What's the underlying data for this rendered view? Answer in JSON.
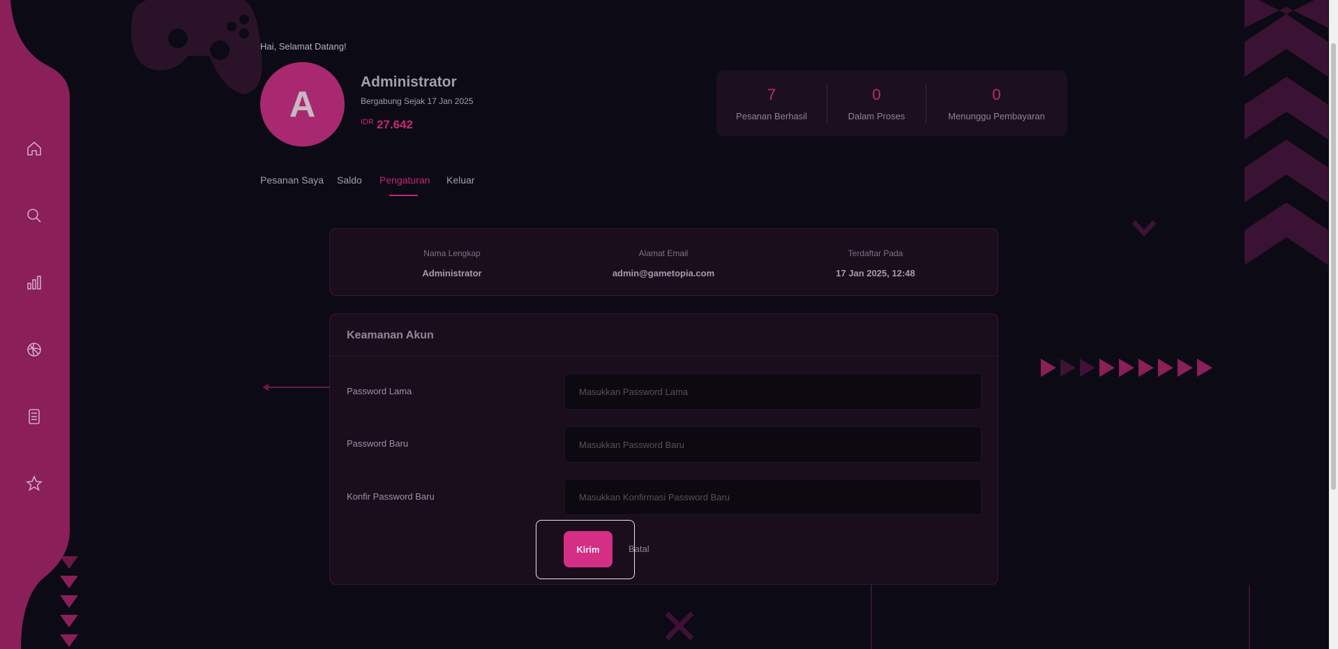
{
  "header": {
    "greeting": "Hai, Selamat Datang!",
    "avatar_initial": "A",
    "user_name": "Administrator",
    "joined": "Bergabung Sejak 17 Jan 2025",
    "balance_currency": "IDR",
    "balance_amount": "27.642"
  },
  "stats": [
    {
      "value": "7",
      "label": "Pesanan Berhasil"
    },
    {
      "value": "0",
      "label": "Dalam Proses"
    },
    {
      "value": "0",
      "label": "Menunggu Pembayaran"
    }
  ],
  "tabs": [
    {
      "label": "Pesanan Saya",
      "active": false
    },
    {
      "label": "Saldo",
      "active": false
    },
    {
      "label": "Pengaturan",
      "active": true
    },
    {
      "label": "Keluar",
      "active": false
    }
  ],
  "info": [
    {
      "key": "Nama Lengkap",
      "value": "Administrator"
    },
    {
      "key": "Alamat Email",
      "value": "admin@gametopia.com"
    },
    {
      "key": "Terdaftar Pada",
      "value": "17 Jan 2025, 12:48"
    }
  ],
  "security": {
    "title": "Keamanan Akun",
    "fields": [
      {
        "label": "Password Lama",
        "placeholder": "Masukkan Password Lama"
      },
      {
        "label": "Password Baru",
        "placeholder": "Masukkan Password Baru"
      },
      {
        "label": "Konfir Password Baru",
        "placeholder": "Masukkan Konfirmasi Password Baru"
      }
    ],
    "submit_label": "Kirim",
    "cancel_label": "Batal"
  },
  "sidebar": {
    "icons": [
      "home-icon",
      "search-icon",
      "chart-icon",
      "globe-icon",
      "calculator-icon",
      "star-icon"
    ]
  },
  "colors": {
    "accent": "#c4287a",
    "sidebar": "#8a1f59",
    "background": "#0c0a14",
    "button": "#d42e85"
  }
}
